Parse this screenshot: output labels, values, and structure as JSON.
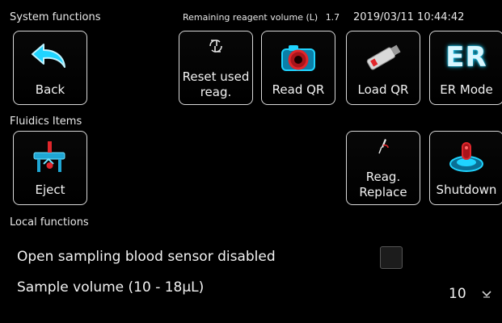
{
  "header": {
    "system_title": "System functions",
    "reagent_label": "Remaining reagent volume (L)",
    "reagent_value": "1.7",
    "datetime": "2019/03/11 10:44:42"
  },
  "system_buttons": {
    "back": "Back",
    "reset_line1": "Reset used",
    "reset_line2": "reag.",
    "read_qr": "Read QR",
    "load_qr": "Load QR",
    "er_mode": "ER Mode",
    "er_icon_text": "ER"
  },
  "fluidics": {
    "title": "Fluidics Items",
    "eject": "Eject",
    "reag_line1": "Reag.",
    "reag_line2": "Replace",
    "shutdown": "Shutdown"
  },
  "local": {
    "title": "Local functions",
    "open_sampling_label": "Open sampling blood sensor disabled",
    "open_sampling_checked": false,
    "sample_volume_label": "Sample volume (10 - 18μL)",
    "sample_volume_value": "10"
  },
  "colors": {
    "background": "#000000",
    "icon_cyan": "#1fd4ff",
    "icon_red": "#e0262b",
    "tile_border": "#d8d8d8"
  }
}
